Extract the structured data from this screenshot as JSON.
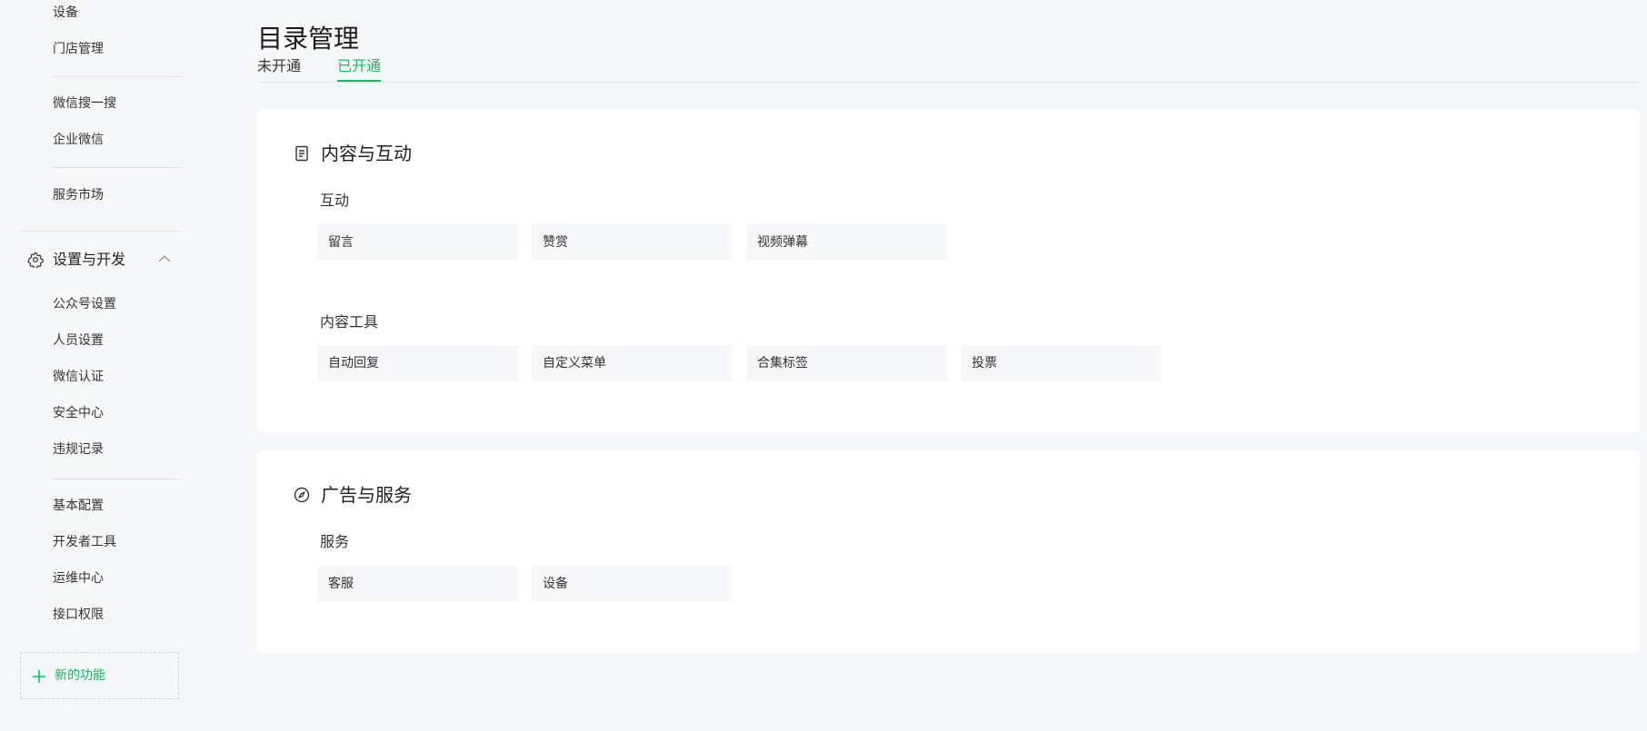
{
  "sidebar": {
    "items_top": [
      {
        "label": "设备"
      },
      {
        "label": "门店管理"
      },
      {
        "label": "微信搜一搜"
      },
      {
        "label": "企业微信"
      },
      {
        "label": "服务市场"
      }
    ],
    "group": {
      "label": "设置与开发",
      "icon": "gear-icon",
      "expanded": true
    },
    "group_items": [
      {
        "label": "公众号设置"
      },
      {
        "label": "人员设置"
      },
      {
        "label": "微信认证"
      },
      {
        "label": "安全中心"
      },
      {
        "label": "违规记录"
      },
      {
        "label": "基本配置"
      },
      {
        "label": "开发者工具"
      },
      {
        "label": "运维中心"
      },
      {
        "label": "接口权限"
      }
    ],
    "new_feature": {
      "label": "新的功能",
      "icon": "plus-icon"
    }
  },
  "main": {
    "title": "目录管理",
    "tabs": [
      {
        "label": "未开通",
        "active": false
      },
      {
        "label": "已开通",
        "active": true
      }
    ],
    "cards": [
      {
        "title": "内容与互动",
        "icon": "document-icon",
        "sections": [
          {
            "label": "互动",
            "features": [
              "留言",
              "赞赏",
              "视频弹幕"
            ]
          },
          {
            "label": "内容工具",
            "features": [
              "自动回复",
              "自定义菜单",
              "合集标签",
              "投票"
            ]
          }
        ]
      },
      {
        "title": "广告与服务",
        "icon": "compass-icon",
        "sections": [
          {
            "label": "服务",
            "features": [
              "客服",
              "设备"
            ]
          }
        ]
      }
    ]
  },
  "colors": {
    "accent": "#07c160",
    "page_bg": "#f6f7f8",
    "card_bg": "#ffffff",
    "feature_bg": "#f6f7f8"
  }
}
